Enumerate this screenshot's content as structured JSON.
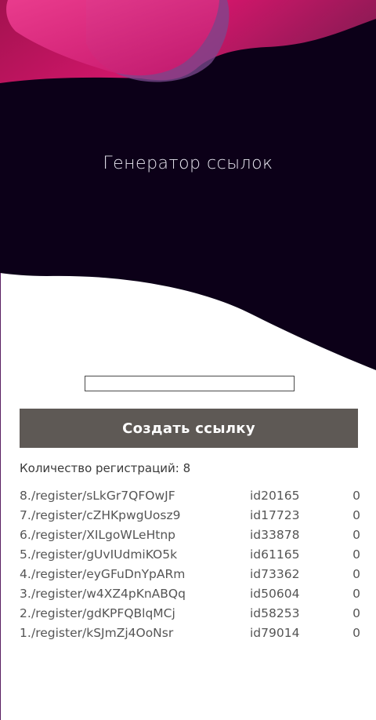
{
  "header": {
    "title": "Генератор ссылок"
  },
  "form": {
    "input_value": "",
    "create_button_label": "Создать ссылку"
  },
  "stats": {
    "registrations_label": "Количество регистраций:",
    "registrations_count": "8"
  },
  "links": [
    {
      "num": "8.",
      "path": "/register/sLkGr7QFOwJF",
      "id": "id20165",
      "count": "0"
    },
    {
      "num": "7.",
      "path": "/register/cZHKpwgUosz9",
      "id": "id17723",
      "count": "0"
    },
    {
      "num": "6.",
      "path": "/register/XILgoWLeHtnp",
      "id": "id33878",
      "count": "0"
    },
    {
      "num": "5.",
      "path": "/register/gUvIUdmiKO5k",
      "id": "id61165",
      "count": "0"
    },
    {
      "num": "4.",
      "path": "/register/eyGFuDnYpARm",
      "id": "id73362",
      "count": "0"
    },
    {
      "num": "3.",
      "path": "/register/w4XZ4pKnABQq",
      "id": "id50604",
      "count": "0"
    },
    {
      "num": "2.",
      "path": "/register/gdKPFQBlqMCj",
      "id": "id58253",
      "count": "0"
    },
    {
      "num": "1.",
      "path": "/register/kSJmZj4OoNsr",
      "id": "id79014",
      "count": "0"
    }
  ],
  "colors": {
    "hero_background": "#0c0018",
    "accent_magenta": "#c2125b",
    "accent_pink": "#e0277a",
    "accent_purple": "#7b4a8f",
    "button_background": "#5e5955"
  }
}
